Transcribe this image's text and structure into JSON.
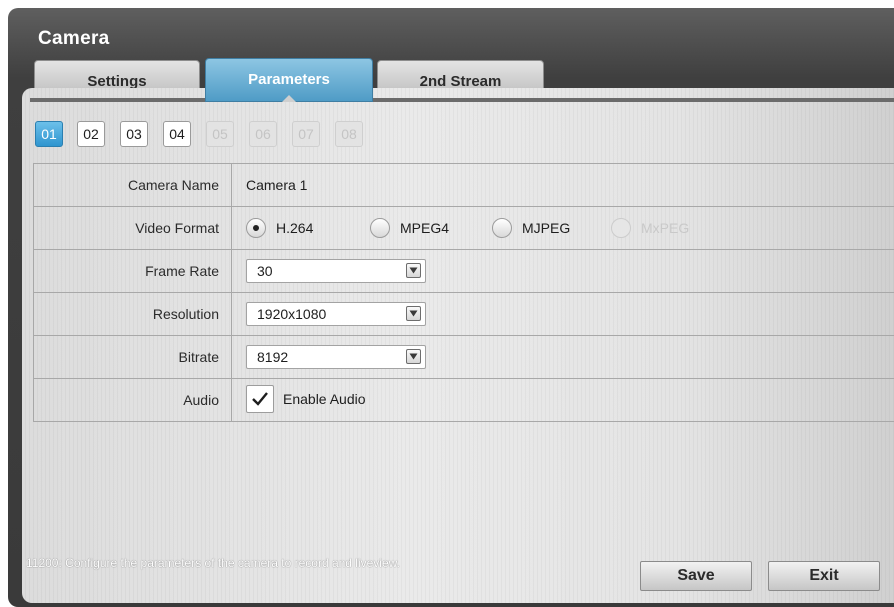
{
  "window": {
    "title": "Camera"
  },
  "tabs": [
    {
      "label": "Settings",
      "active": false
    },
    {
      "label": "Parameters",
      "active": true
    },
    {
      "label": "2nd Stream",
      "active": false
    }
  ],
  "channels": [
    {
      "label": "01",
      "state": "selected"
    },
    {
      "label": "02",
      "state": "enabled"
    },
    {
      "label": "03",
      "state": "enabled"
    },
    {
      "label": "04",
      "state": "enabled"
    },
    {
      "label": "05",
      "state": "disabled"
    },
    {
      "label": "06",
      "state": "disabled"
    },
    {
      "label": "07",
      "state": "disabled"
    },
    {
      "label": "08",
      "state": "disabled"
    }
  ],
  "form": {
    "camera_name": {
      "label": "Camera Name",
      "value": "Camera 1"
    },
    "video_format": {
      "label": "Video Format",
      "options": [
        "H.264",
        "MPEG4",
        "MJPEG",
        "MxPEG"
      ],
      "selected": "H.264",
      "disabled": [
        "MxPEG"
      ]
    },
    "frame_rate": {
      "label": "Frame Rate",
      "value": "30"
    },
    "resolution": {
      "label": "Resolution",
      "value": "1920x1080"
    },
    "bitrate": {
      "label": "Bitrate",
      "value": "8192"
    },
    "audio": {
      "label": "Audio",
      "checkbox_label": "Enable Audio",
      "checked": true
    }
  },
  "footer": {
    "help_text": "11200: Configure the parameters of the camera to record and liveview.",
    "save_label": "Save",
    "exit_label": "Exit"
  },
  "colors": {
    "accent": "#3c9dd2",
    "frame": "#434343",
    "panel": "#e2e2e2"
  }
}
